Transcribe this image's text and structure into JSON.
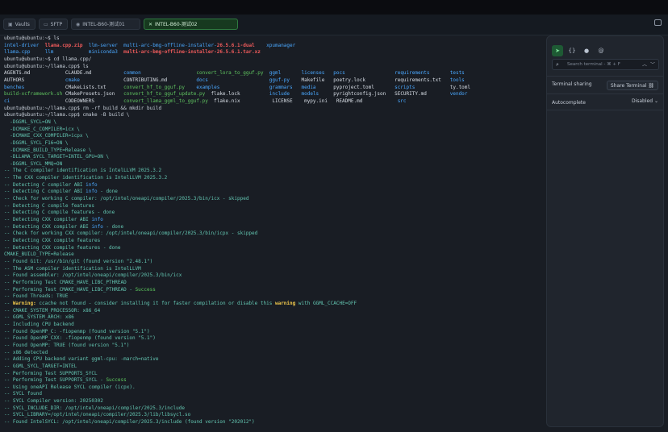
{
  "tabs": [
    {
      "label": "Vaults",
      "icon": "vault-icon"
    },
    {
      "label": "SFTP",
      "icon": "folder-icon"
    },
    {
      "label": "INTEL-B60-测试01",
      "icon": "terminal-icon"
    },
    {
      "label": "INTEL-B60-测试02",
      "icon": "close-icon"
    }
  ],
  "terminal_lines": [
    [
      {
        "t": "ubuntu@ubuntu:~$ ls",
        "c": "prompt"
      }
    ],
    [
      {
        "t": "intel-driver  ",
        "c": "blue"
      },
      {
        "t": "llama.cpp.zip",
        "c": "red"
      },
      {
        "t": "  llm-server  ",
        "c": "blue"
      },
      {
        "t": "multi-arc-bmg-offline-installer-",
        "c": "blue"
      },
      {
        "t": "26.5.6.1-dual",
        "c": "red"
      },
      {
        "t": "    xpumanager",
        "c": "blue"
      }
    ],
    [
      {
        "t": "llama.cpp     ",
        "c": "blue"
      },
      {
        "t": "llm            ",
        "c": "blue"
      },
      {
        "t": "miniconda3  ",
        "c": "blue"
      },
      {
        "t": "multi-arc-bmg-offline-installer-26.5.6.1.tar.xz",
        "c": "red"
      }
    ],
    [
      {
        "t": "ubuntu@ubuntu:~$ cd llama.cpp/",
        "c": "prompt"
      }
    ],
    [
      {
        "t": "ubuntu@ubuntu:~/llama.cpp$ ls",
        "c": "prompt"
      }
    ],
    [
      {
        "t": "AGENTS.md            CLAUDE.md           ",
        "c": "white"
      },
      {
        "t": "common                   ",
        "c": "blue"
      },
      {
        "t": "convert_lora_to_gguf.py  ",
        "c": "green"
      },
      {
        "t": "ggml       ",
        "c": "blue"
      },
      {
        "t": "licenses   ",
        "c": "blue"
      },
      {
        "t": "pocs                 ",
        "c": "blue"
      },
      {
        "t": "requirements       ",
        "c": "blue"
      },
      {
        "t": "tests",
        "c": "blue"
      }
    ],
    [
      {
        "t": "AUTHORS              ",
        "c": "white"
      },
      {
        "t": "cmake               ",
        "c": "blue"
      },
      {
        "t": "CONTRIBUTING.md          ",
        "c": "white"
      },
      {
        "t": "docs                     ",
        "c": "blue"
      },
      {
        "t": "gguf-py    ",
        "c": "blue"
      },
      {
        "t": "Makefile   poetry.lock          requirements.txt   ",
        "c": "white"
      },
      {
        "t": "tools",
        "c": "blue"
      }
    ],
    [
      {
        "t": "benches              ",
        "c": "blue"
      },
      {
        "t": "CMakeLists.txt      ",
        "c": "white"
      },
      {
        "t": "convert_hf_to_gguf.py    ",
        "c": "green"
      },
      {
        "t": "examples                 ",
        "c": "blue"
      },
      {
        "t": "grammars   ",
        "c": "blue"
      },
      {
        "t": "media      ",
        "c": "blue"
      },
      {
        "t": "pyproject.toml       ",
        "c": "white"
      },
      {
        "t": "scripts            ",
        "c": "blue"
      },
      {
        "t": "ty.toml",
        "c": "white"
      }
    ],
    [
      {
        "t": "build-xcframework.sh ",
        "c": "green"
      },
      {
        "t": "CMakePresets.json   ",
        "c": "white"
      },
      {
        "t": "convert_hf_to_gguf_update.py  ",
        "c": "green"
      },
      {
        "t": "flake.lock          ",
        "c": "white"
      },
      {
        "t": "include    ",
        "c": "blue"
      },
      {
        "t": "models     ",
        "c": "blue"
      },
      {
        "t": "pyrightconfig.json   SECURITY.md        ",
        "c": "white"
      },
      {
        "t": "vendor",
        "c": "blue"
      }
    ],
    [
      {
        "t": "ci                   ",
        "c": "blue"
      },
      {
        "t": "CODEOWNERS          ",
        "c": "white"
      },
      {
        "t": "convert_llama_ggml_to_gguf.py  ",
        "c": "green"
      },
      {
        "t": "flake.nix           ",
        "c": "white"
      },
      {
        "t": "LICENSE    mypy.ini   README.md            ",
        "c": "white"
      },
      {
        "t": "src",
        "c": "blue"
      }
    ],
    [
      {
        "t": "ubuntu@ubuntu:~/llama.cpp$ rm -rf build && mkdir build",
        "c": "prompt"
      }
    ],
    [
      {
        "t": "ubuntu@ubuntu:~/llama.cpp$ cmake -B build \\",
        "c": "prompt"
      }
    ],
    [
      {
        "t": "  -DGGML_SYCL=ON \\",
        "c": "teal"
      }
    ],
    [
      {
        "t": "  -DCMAKE_C_COMPILER=icx \\",
        "c": "teal"
      }
    ],
    [
      {
        "t": "  -DCMAKE_CXX_COMPILER=icpx \\",
        "c": "teal"
      }
    ],
    [
      {
        "t": "  -DGGML_SYCL_F16=ON \\",
        "c": "teal"
      }
    ],
    [
      {
        "t": "  -DCMAKE_BUILD_TYPE=Release \\",
        "c": "teal"
      }
    ],
    [
      {
        "t": "  -DLLAMA_SYCL_TARGET=INTEL_GPU=ON \\",
        "c": "teal"
      }
    ],
    [
      {
        "t": "  -DGGML_SYCL_MMQ=ON",
        "c": "teal"
      }
    ],
    [
      {
        "t": "-- The C compiler identification is IntelLLVM 2025.3.2",
        "c": "teal"
      }
    ],
    [
      {
        "t": "-- The CXX compiler identification is IntelLLVM 2025.3.2",
        "c": "teal"
      }
    ],
    [
      {
        "t": "-- Detecting C compiler ABI ",
        "c": "teal"
      },
      {
        "t": "info",
        "c": "blue"
      }
    ],
    [
      {
        "t": "-- Detecting C compiler ABI ",
        "c": "teal"
      },
      {
        "t": "info",
        "c": "blue"
      },
      {
        "t": " - done",
        "c": "teal"
      }
    ],
    [
      {
        "t": "-- Check for working C compiler: /opt/intel/oneapi/compiler/2025.3/bin/icx - skipped",
        "c": "teal"
      }
    ],
    [
      {
        "t": "-- Detecting C compile features",
        "c": "teal"
      }
    ],
    [
      {
        "t": "-- Detecting C compile features - done",
        "c": "teal"
      }
    ],
    [
      {
        "t": "-- Detecting CXX compiler ABI ",
        "c": "teal"
      },
      {
        "t": "info",
        "c": "blue"
      }
    ],
    [
      {
        "t": "-- Detecting CXX compiler ABI ",
        "c": "teal"
      },
      {
        "t": "info",
        "c": "blue"
      },
      {
        "t": " - done",
        "c": "teal"
      }
    ],
    [
      {
        "t": "-- Check for working CXX compiler: /opt/intel/oneapi/compiler/2025.3/bin/icpx - skipped",
        "c": "teal"
      }
    ],
    [
      {
        "t": "-- Detecting CXX compile features",
        "c": "teal"
      }
    ],
    [
      {
        "t": "-- Detecting CXX compile features - done",
        "c": "teal"
      }
    ],
    [
      {
        "t": "CMAKE_BUILD_TYPE=Release",
        "c": "teal"
      }
    ],
    [
      {
        "t": "-- Found Git: /usr/bin/git (found version \"2.48.1\")",
        "c": "teal"
      }
    ],
    [
      {
        "t": "-- The ASM compiler identification is IntelLLVM",
        "c": "teal"
      }
    ],
    [
      {
        "t": "-- Found assembler: /opt/intel/oneapi/compiler/2025.3/bin/icx",
        "c": "teal"
      }
    ],
    [
      {
        "t": "-- Performing Test CMAKE_HAVE_LIBC_PTHREAD",
        "c": "teal"
      }
    ],
    [
      {
        "t": "-- Performing Test CMAKE_HAVE_LIBC_PTHREAD - ",
        "c": "teal"
      },
      {
        "t": "Success",
        "c": "grn"
      }
    ],
    [
      {
        "t": "-- Found Threads: TRUE",
        "c": "teal"
      }
    ],
    [
      {
        "t": "-- ",
        "c": "teal"
      },
      {
        "t": "Warning:",
        "c": "warn"
      },
      {
        "t": " ccache not found - consider installing it for faster compilation or disable this ",
        "c": "teal"
      },
      {
        "t": "warning",
        "c": "warn"
      },
      {
        "t": " with GGML_CCACHE=OFF",
        "c": "teal"
      }
    ],
    [
      {
        "t": "-- CMAKE_SYSTEM_PROCESSOR: x86_64",
        "c": "teal"
      }
    ],
    [
      {
        "t": "-- GGML_SYSTEM_ARCH: x86",
        "c": "teal"
      }
    ],
    [
      {
        "t": "-- Including CPU backend",
        "c": "teal"
      }
    ],
    [
      {
        "t": "-- Found OpenMP_C: -fiopenmp (found version \"5.1\")",
        "c": "teal"
      }
    ],
    [
      {
        "t": "-- Found OpenMP_CXX: -fiopenmp (found version \"5.1\")",
        "c": "teal"
      }
    ],
    [
      {
        "t": "-- Found OpenMP: TRUE (found version \"5.1\")",
        "c": "teal"
      }
    ],
    [
      {
        "t": "-- x86 detected",
        "c": "teal"
      }
    ],
    [
      {
        "t": "-- Adding CPU backend variant ggml-cpu: -march=native",
        "c": "teal"
      }
    ],
    [
      {
        "t": "-- GGML_SYCL_TARGET=INTEL",
        "c": "teal"
      }
    ],
    [
      {
        "t": "-- Performing Test SUPPORTS_SYCL",
        "c": "teal"
      }
    ],
    [
      {
        "t": "-- Performing Test SUPPORTS_SYCL - ",
        "c": "teal"
      },
      {
        "t": "Success",
        "c": "grn"
      }
    ],
    [
      {
        "t": "-- Using oneAPI Release SYCL compiler (icpx).",
        "c": "teal"
      }
    ],
    [
      {
        "t": "-- SYCL found",
        "c": "teal"
      }
    ],
    [
      {
        "t": "-- SYCL Compiler version: 20250302",
        "c": "teal"
      }
    ],
    [
      {
        "t": "-- SYCL_INCLUDE_DIR: /opt/intel/oneapi/compiler/2025.3/include",
        "c": "teal"
      }
    ],
    [
      {
        "t": "-- SYCL_LIBRARY=/opt/intel/oneapi/compiler/2025.3/lib/libsycl.so",
        "c": "teal"
      }
    ],
    [
      {
        "t": "-- Found IntelSYCL: /opt/intel/oneapi/compiler/2025.3/include (found version \"202012\")",
        "c": "teal"
      }
    ]
  ],
  "sidepanel": {
    "icons": [
      "send-icon",
      "code-icon",
      "info-icon",
      "at-icon"
    ],
    "search_placeholder": "Search terminal - ⌘ + F",
    "terminal_sharing_label": "Terminal sharing",
    "share_button": "Share Terminal",
    "autocomplete_label": "Autocomplete",
    "autocomplete_value": "Disabled"
  }
}
